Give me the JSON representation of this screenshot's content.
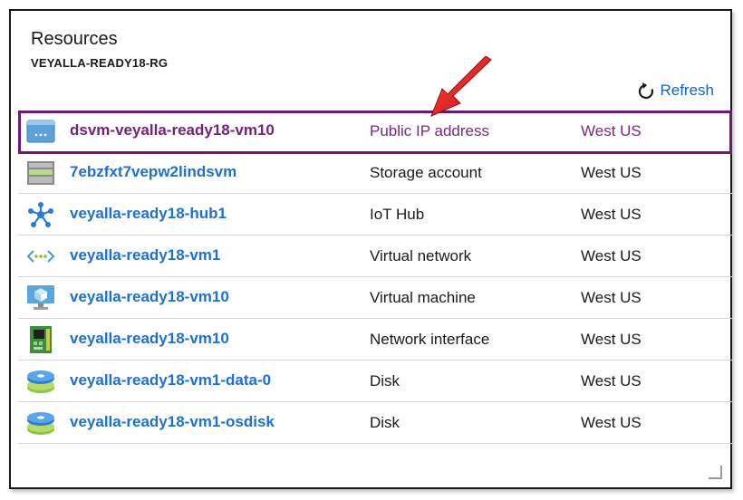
{
  "panel": {
    "title": "Resources",
    "subtitle": "VEYALLA-READY18-RG",
    "refresh_label": "Refresh"
  },
  "resources": [
    {
      "name": "dsvm-veyalla-ready18-vm10",
      "type": "Public IP address",
      "location": "West US",
      "icon": "public-ip-icon",
      "highlighted": true
    },
    {
      "name": "7ebzfxt7vepw2lindsvm",
      "type": "Storage account",
      "location": "West US",
      "icon": "storage-account-icon"
    },
    {
      "name": "veyalla-ready18-hub1",
      "type": "IoT Hub",
      "location": "West US",
      "icon": "iot-hub-icon"
    },
    {
      "name": "veyalla-ready18-vm1",
      "type": "Virtual network",
      "location": "West US",
      "icon": "virtual-network-icon"
    },
    {
      "name": "veyalla-ready18-vm10",
      "type": "Virtual machine",
      "location": "West US",
      "icon": "virtual-machine-icon"
    },
    {
      "name": "veyalla-ready18-vm10",
      "type": "Network interface",
      "location": "West US",
      "icon": "network-interface-icon"
    },
    {
      "name": "veyalla-ready18-vm1-data-0",
      "type": "Disk",
      "location": "West US",
      "icon": "disk-icon"
    },
    {
      "name": "veyalla-ready18-vm1-osdisk",
      "type": "Disk",
      "location": "West US",
      "icon": "disk-icon"
    }
  ],
  "colors": {
    "link": "#1f6fcf",
    "highlight": "#742476",
    "arrow": "#e0141c"
  }
}
